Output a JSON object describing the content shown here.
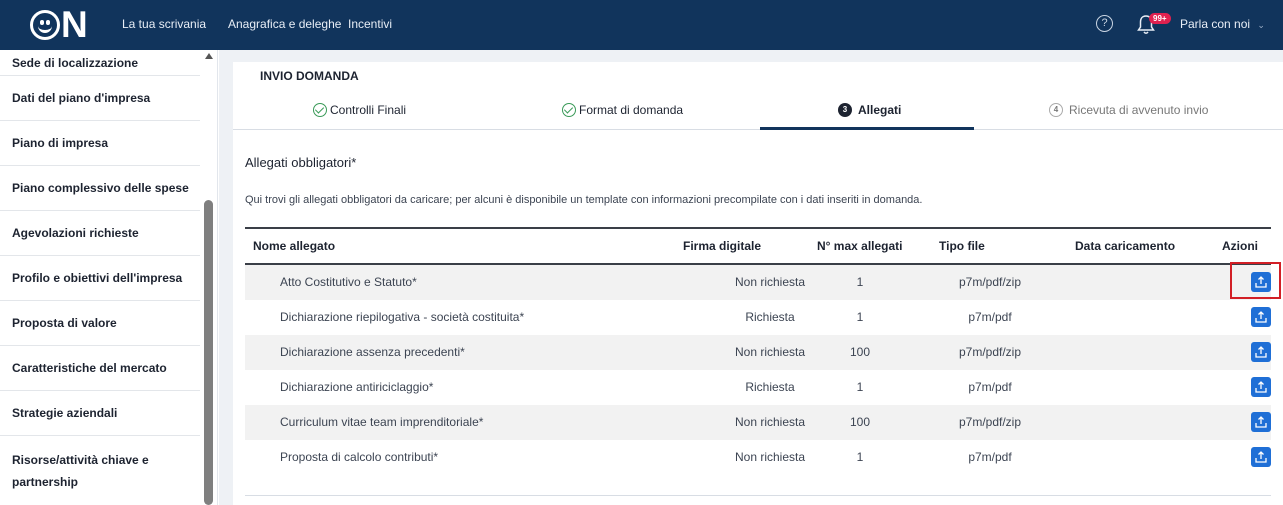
{
  "header": {
    "logo_text": "N",
    "nav": [
      "La tua scrivania",
      "Anagrafica e deleghe",
      "Incentivi"
    ],
    "help_icon": "?",
    "notification_badge": "99+",
    "talk_label": "Parla con noi"
  },
  "sidebar": {
    "items": [
      "Sede di localizzazione",
      "Dati del piano d'impresa",
      "Piano di impresa",
      "Piano complessivo delle spese",
      "Agevolazioni richieste",
      "Profilo e obiettivi dell'impresa",
      "Proposta di valore",
      "Caratteristiche del mercato",
      "Strategie aziendali",
      "Risorse/attività chiave e partnership"
    ]
  },
  "main": {
    "card_title": "INVIO DOMANDA",
    "steps": [
      {
        "label": "Controlli Finali",
        "state": "done"
      },
      {
        "label": "Format di domanda",
        "state": "done"
      },
      {
        "label": "Allegati",
        "number": "3",
        "state": "active"
      },
      {
        "label": "Ricevuta di avvenuto invio",
        "number": "4",
        "state": "todo"
      }
    ],
    "section_title": "Allegati obbligatori*",
    "section_desc": "Qui trovi gli allegati obbligatori da caricare; per alcuni è disponibile un template con informazioni precompilate con i dati inseriti in domanda.",
    "table": {
      "headers": [
        "Nome allegato",
        "Firma digitale",
        "N° max allegati",
        "Tipo file",
        "Data caricamento",
        "Azioni"
      ],
      "rows": [
        {
          "name": "Atto Costitutivo e Statuto*",
          "sign": "Non richiesta",
          "max": "1",
          "type": "p7m/pdf/zip",
          "date": ""
        },
        {
          "name": "Dichiarazione riepilogativa - società costituita*",
          "sign": "Richiesta",
          "max": "1",
          "type": "p7m/pdf",
          "date": ""
        },
        {
          "name": "Dichiarazione assenza precedenti*",
          "sign": "Non richiesta",
          "max": "100",
          "type": "p7m/pdf/zip",
          "date": ""
        },
        {
          "name": "Dichiarazione antiriciclaggio*",
          "sign": "Richiesta",
          "max": "1",
          "type": "p7m/pdf",
          "date": ""
        },
        {
          "name": "Curriculum vitae team imprenditoriale*",
          "sign": "Non richiesta",
          "max": "100",
          "type": "p7m/pdf/zip",
          "date": ""
        },
        {
          "name": "Proposta di calcolo contributi*",
          "sign": "Non richiesta",
          "max": "1",
          "type": "p7m/pdf",
          "date": ""
        }
      ]
    }
  },
  "colors": {
    "topbar": "#11345c",
    "accent": "#1f6fd6",
    "highlight": "#d21f26",
    "success": "#3a9a58"
  }
}
